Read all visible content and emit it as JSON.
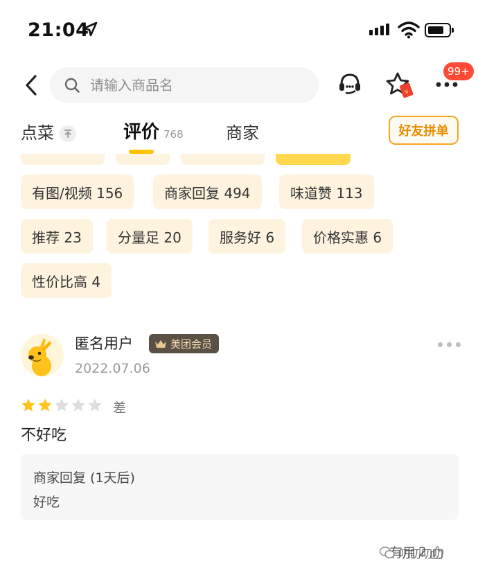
{
  "status_bar": {
    "time": "21:04"
  },
  "nav": {
    "search_placeholder": "请输入商品名",
    "badge": "99+"
  },
  "tabs": [
    {
      "label": "点菜"
    },
    {
      "label": "评价",
      "count": "768"
    },
    {
      "label": "商家"
    }
  ],
  "group_buy_label": "好友拼单",
  "tags": [
    {
      "label": "有图/视频 156"
    },
    {
      "label": "商家回复 494"
    },
    {
      "label": "味道赞 113"
    },
    {
      "label": "推荐 23"
    },
    {
      "label": "分量足 20"
    },
    {
      "label": "服务好 6"
    },
    {
      "label": "价格实惠 6"
    },
    {
      "label": "性价比高 4"
    }
  ],
  "review": {
    "username": "匿名用户",
    "member_badge": "美团会员",
    "date": "2022.07.06",
    "rating": 2,
    "rating_max": 5,
    "rating_label": "差",
    "text": "不好吃",
    "reply_title": "商家回复 (1天后)",
    "reply_text": "好吃",
    "helpful_label": "有用",
    "helpful_count": "2"
  },
  "watermark": "叨叨叨叨",
  "colors": {
    "accent": "#ffc300",
    "tag_bg": "#fdf3de",
    "badge_red": "#ff4a36",
    "group_buy": "#e58b00",
    "star_on": "#ffc21a",
    "star_off": "#dddddd"
  },
  "icons": {
    "back": "chevron-left-icon",
    "search": "search-icon",
    "service": "customer-service-icon",
    "favorite": "star-redpacket-icon",
    "more": "more-icon"
  }
}
